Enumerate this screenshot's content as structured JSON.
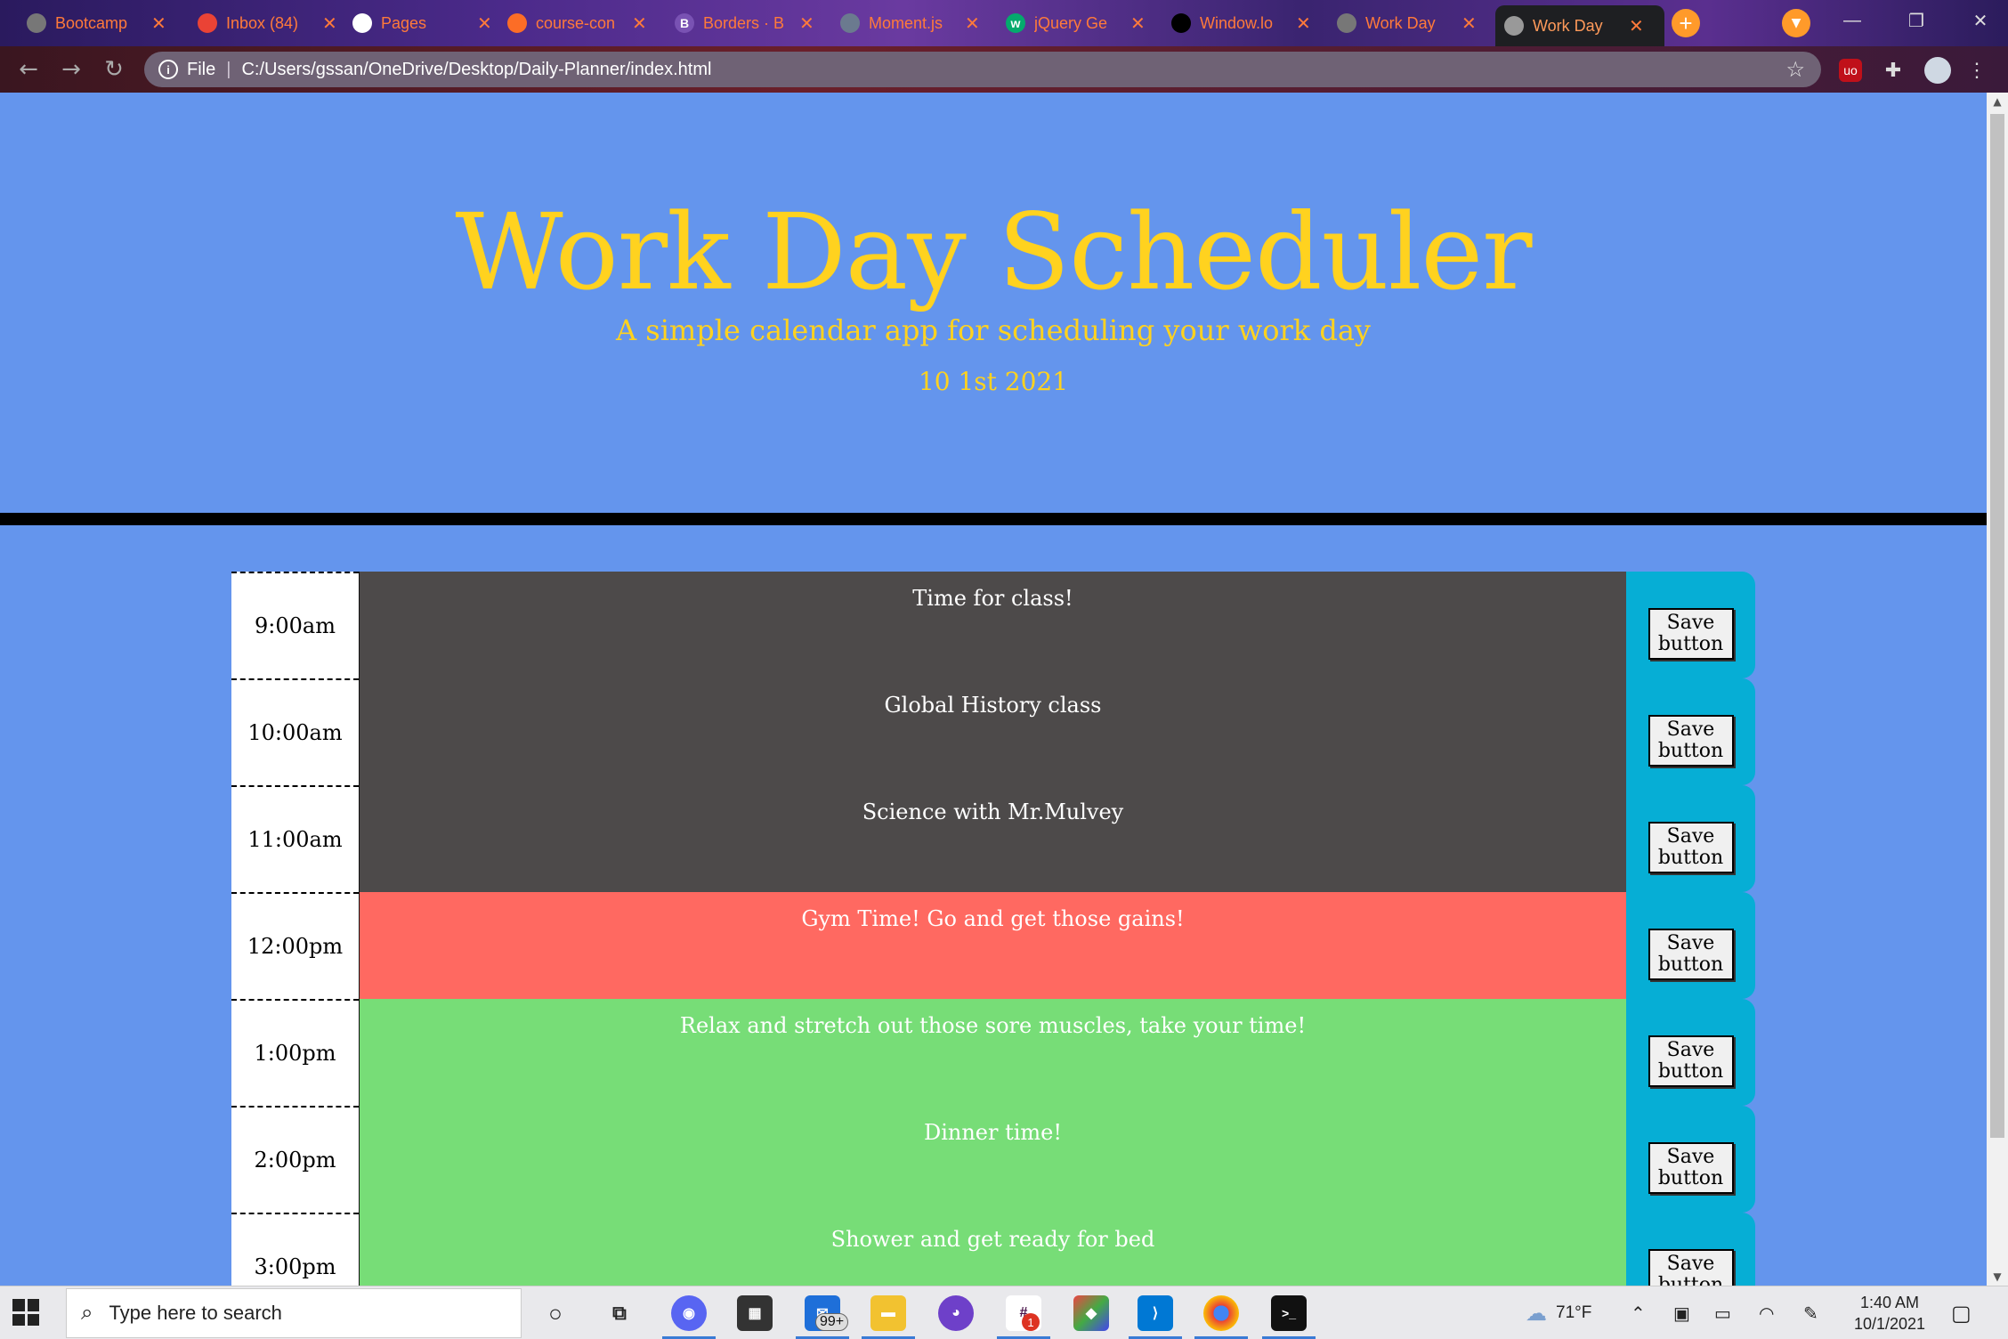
{
  "browser": {
    "tabs": [
      {
        "title": "Bootcamp",
        "favicon": "globe-icon",
        "color": "#777777"
      },
      {
        "title": "Inbox (84)",
        "favicon": "gmail-icon",
        "color": "#ea4335"
      },
      {
        "title": "Pages",
        "favicon": "github-icon",
        "color": "#ffffff"
      },
      {
        "title": "course-con",
        "favicon": "gitlab-icon",
        "color": "#fc6d26"
      },
      {
        "title": "Borders · B",
        "favicon": "bootstrap-icon",
        "color": "#7952b3",
        "glyph": "B"
      },
      {
        "title": "Moment.js",
        "favicon": "clock-icon",
        "color": "#6b7a8f"
      },
      {
        "title": "jQuery Ge",
        "favicon": "w3-icon",
        "color": "#04aa6d",
        "glyph": "w"
      },
      {
        "title": "Window.lo",
        "favicon": "mdn-icon",
        "color": "#000000"
      },
      {
        "title": "Work Day",
        "favicon": "globe-icon",
        "color": "#777777"
      },
      {
        "title": "Work Day",
        "favicon": "globe-icon",
        "color": "#999999",
        "active": true
      }
    ],
    "address": {
      "scheme": "File",
      "url": "C:/Users/gssan/OneDrive/Desktop/Daily-Planner/index.html"
    }
  },
  "page": {
    "title": "Work Day Scheduler",
    "lead": "A simple calendar app for scheduling your work day",
    "current_day": "10 1st 2021",
    "colors": {
      "past": "#4d4a4a",
      "present": "#ff6961",
      "future": "#77dd77",
      "save": "#06aed5",
      "heading": "#ffd21f",
      "background": "#6495ed"
    },
    "save_label": "Save button",
    "rows": [
      {
        "hour": "9:00am",
        "text": "Time for class!",
        "state": "past"
      },
      {
        "hour": "10:00am",
        "text": "Global History class",
        "state": "past"
      },
      {
        "hour": "11:00am",
        "text": "Science with Mr.Mulvey",
        "state": "past"
      },
      {
        "hour": "12:00pm",
        "text": "Gym Time! Go and get those gains!",
        "state": "present"
      },
      {
        "hour": "1:00pm",
        "text": "Relax and stretch out those sore muscles, take your time!",
        "state": "future"
      },
      {
        "hour": "2:00pm",
        "text": "Dinner time!",
        "state": "future"
      },
      {
        "hour": "3:00pm",
        "text": "Shower and get ready for bed",
        "state": "future"
      }
    ]
  },
  "taskbar": {
    "search_placeholder": "Type here to search",
    "mail_badge": "99+",
    "slack_badge": "1",
    "weather": "71°F",
    "time": "1:40 AM",
    "date": "10/1/2021"
  }
}
